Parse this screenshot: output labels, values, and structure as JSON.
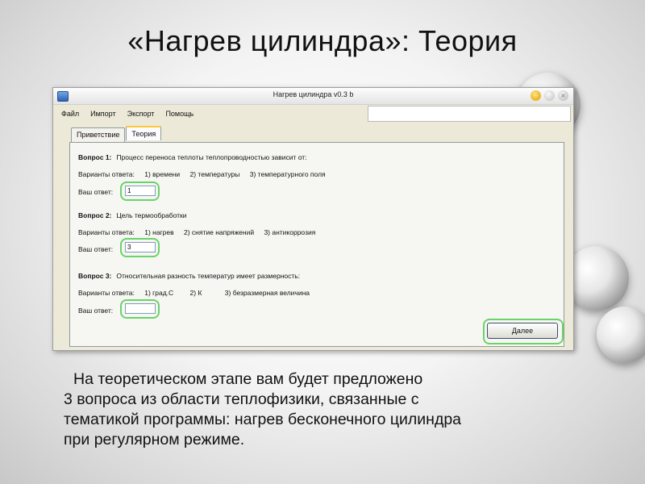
{
  "slide": {
    "title": "«Нагрев цилиндра»: Теория",
    "body_lines": [
      "На теоретическом этапе вам будет предложено",
      "3 вопроса из области теплофизики, связанные с",
      "тематикой программы: нагрев бесконечного цилиндра",
      "при регулярном режиме."
    ]
  },
  "window": {
    "title": "Нагрев цилиндра v0.3 b",
    "controls": {
      "minimize": "–",
      "maximize": "",
      "close": "×"
    }
  },
  "menu": [
    "Файл",
    "Импорт",
    "Экспорт",
    "Помощь"
  ],
  "tabs": [
    "Приветствие",
    "Теория"
  ],
  "active_tab": "Теория",
  "questions": [
    {
      "label": "Вопрос 1:",
      "text": "Процесс переноса теплоты теплопроводностью зависит от:",
      "variants_label": "Варианты ответа:",
      "options": [
        "1) времени",
        "2) температуры",
        "3) температурного поля"
      ],
      "answer_label": "Ваш ответ:",
      "answer_value": "1"
    },
    {
      "label": "Вопрос 2:",
      "text": "Цель термообработки",
      "variants_label": "Варианты ответа:",
      "options": [
        "1) нагрев",
        "2) снятие напряжений",
        "3) антикоррозия"
      ],
      "answer_label": "Ваш ответ:",
      "answer_value": "3"
    },
    {
      "label": "Вопрос 3:",
      "text": "Относительная разность температур имеет размерность:",
      "variants_label": "Варианты ответа:",
      "options": [
        "1) град.С",
        "2) К",
        "3) безразмерная величина"
      ],
      "answer_label": "Ваш ответ:",
      "answer_value": ""
    }
  ],
  "next_button": "Далее",
  "colors": {
    "highlight": "#6ad36a",
    "window_bg": "#ece9d8",
    "tab_accent": "#ffc83c"
  }
}
